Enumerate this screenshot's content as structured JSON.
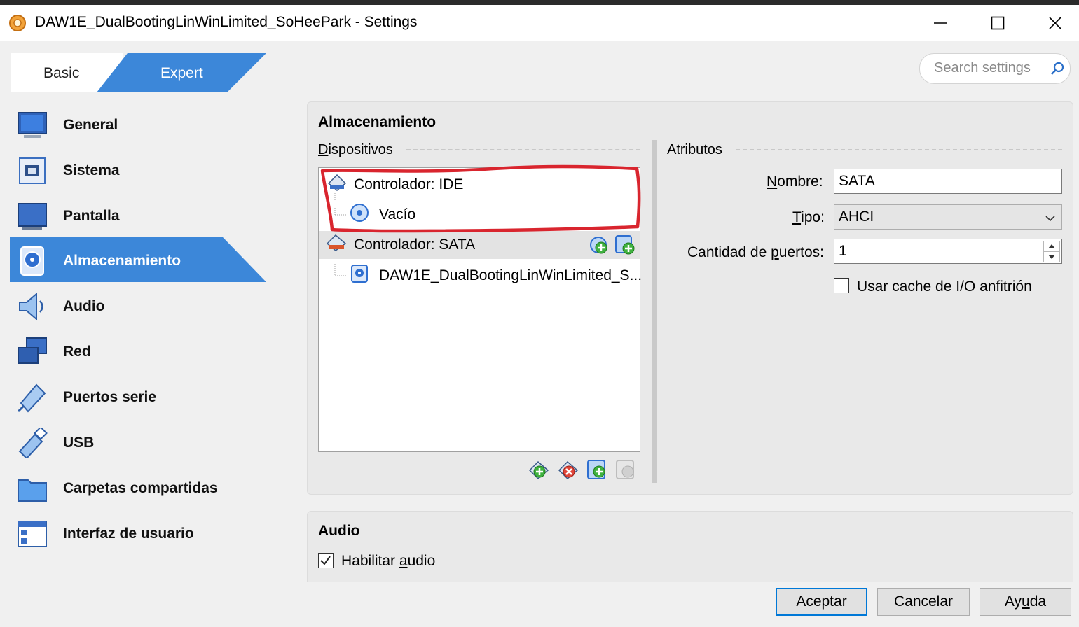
{
  "window": {
    "title": "DAW1E_DualBootingLinWinLimited_SoHeePark - Settings",
    "minimize_label": "—",
    "maximize_label": "☐",
    "close_label": "✕"
  },
  "mode_toggle": {
    "basic": "Basic",
    "expert": "Expert",
    "selected": "Expert"
  },
  "search": {
    "placeholder": "Search settings"
  },
  "sidebar": {
    "items": [
      {
        "label": "General",
        "icon": "monitor-icon"
      },
      {
        "label": "Sistema",
        "icon": "chip-icon"
      },
      {
        "label": "Pantalla",
        "icon": "display-icon"
      },
      {
        "label": "Almacenamiento",
        "icon": "storage-disk-icon",
        "active": true
      },
      {
        "label": "Audio",
        "icon": "speaker-icon"
      },
      {
        "label": "Red",
        "icon": "network-icon"
      },
      {
        "label": "Puertos serie",
        "icon": "serial-port-icon"
      },
      {
        "label": "USB",
        "icon": "usb-icon"
      },
      {
        "label": "Carpetas compartidas",
        "icon": "folder-icon"
      },
      {
        "label": "Interfaz de usuario",
        "icon": "window-layout-icon"
      }
    ]
  },
  "storage": {
    "title": "Almacenamiento",
    "devices_label_first": "D",
    "devices_label_rest": "ispositivos",
    "tree": {
      "ide_controller": "Controlador: IDE",
      "ide_empty": "Vacío",
      "sata_controller": "Controlador: SATA",
      "sata_disk": "DAW1E_DualBootingLinWinLimited_S..."
    },
    "attributes": {
      "title": "Atributos",
      "name_label_first": "N",
      "name_label_rest": "ombre:",
      "name_value": "SATA",
      "type_label_first": "T",
      "type_label_rest": "ipo:",
      "type_value": "AHCI",
      "ports_label_before": "Cantidad de ",
      "ports_label_underlined": "p",
      "ports_label_after": "uertos:",
      "ports_value": "1",
      "host_cache_label": "Usar cache de I/O anfitrión",
      "host_cache_checked": false
    }
  },
  "audio": {
    "title": "Audio",
    "enable_label_before": "Habilitar ",
    "enable_label_underlined": "a",
    "enable_label_after": "udio",
    "enabled": true
  },
  "buttons": {
    "ok": "Aceptar",
    "cancel": "Cancelar",
    "help_before": "Ay",
    "help_underlined": "u",
    "help_after": "da"
  },
  "colors": {
    "accent": "#3c87d9",
    "annotation_red": "#d9252e",
    "title_bar": "#ffffff",
    "panel": "#e9e9e9"
  }
}
